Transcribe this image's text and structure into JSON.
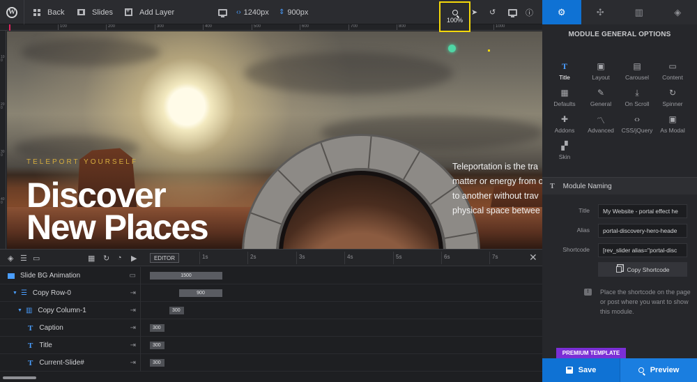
{
  "toolbar": {
    "back_label": "Back",
    "slides_label": "Slides",
    "add_layer_label": "Add Layer",
    "width_value": "1240px",
    "height_value": "900px",
    "zoom_label": "100%"
  },
  "ruler": {
    "top_ticks": [
      "100",
      "200",
      "300",
      "400",
      "500",
      "600",
      "700",
      "800",
      "900",
      "1000"
    ],
    "left_ticks": [
      "100",
      "200",
      "300",
      "400"
    ]
  },
  "slide": {
    "subtitle": "TELEPORT YOURSELF",
    "title_line1": "Discover",
    "title_line2": "New Places",
    "body_lines": [
      "Teleportation is the tra",
      "matter or energy from o",
      "to another without trav",
      "physical space betwee"
    ]
  },
  "timeline": {
    "editor_tab": "EDITOR",
    "seconds": [
      "1s",
      "2s",
      "3s",
      "4s",
      "5s",
      "6s",
      "7s"
    ],
    "rows": [
      {
        "label": "Slide BG Animation",
        "bar": "1500"
      },
      {
        "label": "Copy Row-0",
        "bar": "900"
      },
      {
        "label": "Copy Column-1",
        "bar": "300"
      },
      {
        "label": "Caption",
        "bar": "300"
      },
      {
        "label": "Title",
        "bar": "300"
      },
      {
        "label": "Current-Slide#",
        "bar": "300"
      }
    ]
  },
  "panel": {
    "title": "MODULE GENERAL OPTIONS",
    "options": [
      {
        "label": "Title",
        "icon": "title-icon"
      },
      {
        "label": "Layout",
        "icon": "layout-icon"
      },
      {
        "label": "Carousel",
        "icon": "carousel-icon"
      },
      {
        "label": "Content",
        "icon": "content-icon"
      },
      {
        "label": "Defaults",
        "icon": "defaults-icon"
      },
      {
        "label": "General",
        "icon": "wrench-icon"
      },
      {
        "label": "On Scroll",
        "icon": "scroll-icon"
      },
      {
        "label": "Spinner",
        "icon": "spinner-icon"
      },
      {
        "label": "Addons",
        "icon": "puzzle-icon"
      },
      {
        "label": "Advanced",
        "icon": "chart-icon"
      },
      {
        "label": "CSS/jQuery",
        "icon": "code-icon"
      },
      {
        "label": "As Modal",
        "icon": "modal-icon"
      },
      {
        "label": "Skin",
        "icon": "brush-icon"
      }
    ],
    "naming_header": "Module Naming",
    "fields": [
      {
        "label": "Title",
        "value": "My Website - portal effect he"
      },
      {
        "label": "Alias",
        "value": "portal-discovery-hero-heade"
      },
      {
        "label": "Shortcode",
        "value": "[rev_slider alias=\"portal-disc"
      }
    ],
    "copy_shortcode": "Copy Shortcode",
    "hint": "Place the shortcode on the page or post where you want to show this module.",
    "premium_badge": "PREMIUM TEMPLATE",
    "save_label": "Save",
    "preview_label": "Preview"
  },
  "colors": {
    "accent_blue": "#0f72d4",
    "highlight_yellow": "#f5d90a",
    "premium_purple": "#7b2fd6",
    "subtitle_gold": "#d6ad3e"
  }
}
